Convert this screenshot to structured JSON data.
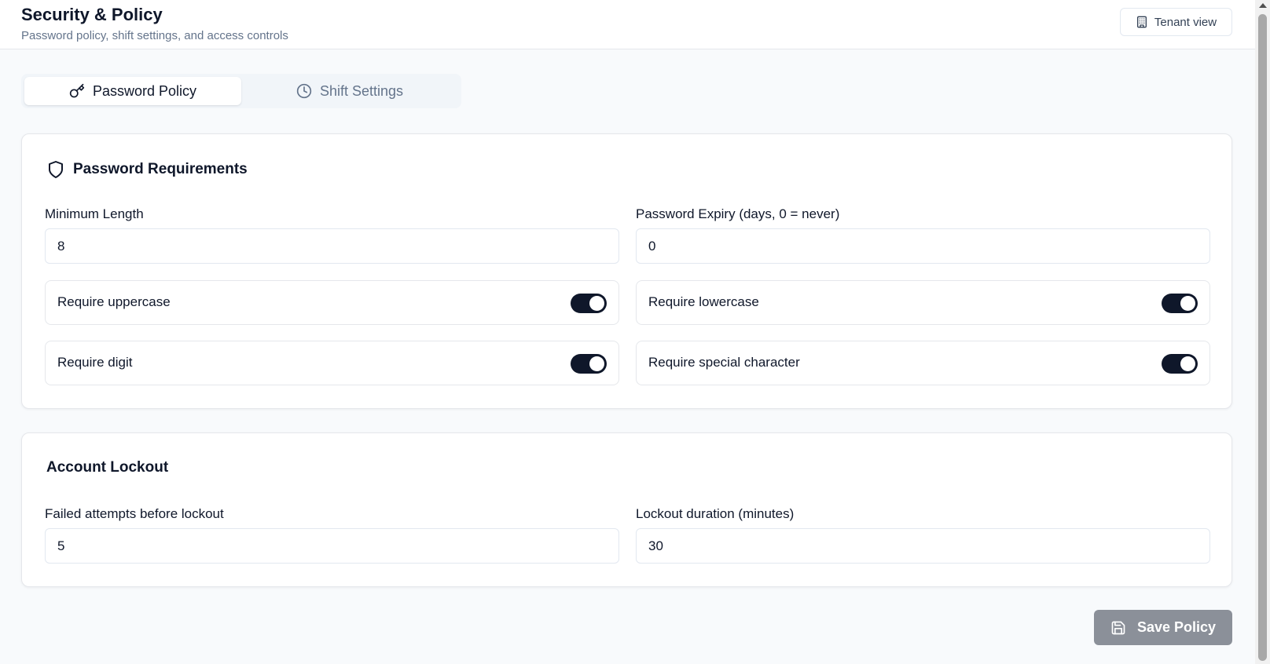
{
  "header": {
    "title": "Security & Policy",
    "subtitle": "Password policy, shift settings, and access controls",
    "tenant_view_label": "Tenant view",
    "tenant_icon": "building-icon"
  },
  "tabs": [
    {
      "label": "Password Policy",
      "icon": "key-icon",
      "active": true
    },
    {
      "label": "Shift Settings",
      "icon": "clock-icon",
      "active": false
    }
  ],
  "password_requirements": {
    "title": "Password Requirements",
    "icon": "shield-icon",
    "min_length": {
      "label": "Minimum Length",
      "value": "8"
    },
    "expiry": {
      "label": "Password Expiry (days, 0 = never)",
      "value": "0"
    },
    "toggles": [
      {
        "label": "Require uppercase",
        "enabled": true
      },
      {
        "label": "Require lowercase",
        "enabled": true
      },
      {
        "label": "Require digit",
        "enabled": true
      },
      {
        "label": "Require special character",
        "enabled": true
      }
    ]
  },
  "account_lockout": {
    "title": "Account Lockout",
    "failed_attempts": {
      "label": "Failed attempts before lockout",
      "value": "5"
    },
    "duration": {
      "label": "Lockout duration (minutes)",
      "value": "30"
    }
  },
  "save_button": {
    "label": "Save Policy",
    "icon": "save-icon",
    "disabled": true
  },
  "colors": {
    "accent": "#0f172a",
    "muted_text": "#64748b",
    "border": "#e5e7eb",
    "background": "#f8fafc",
    "save_disabled": "#8b9099"
  }
}
